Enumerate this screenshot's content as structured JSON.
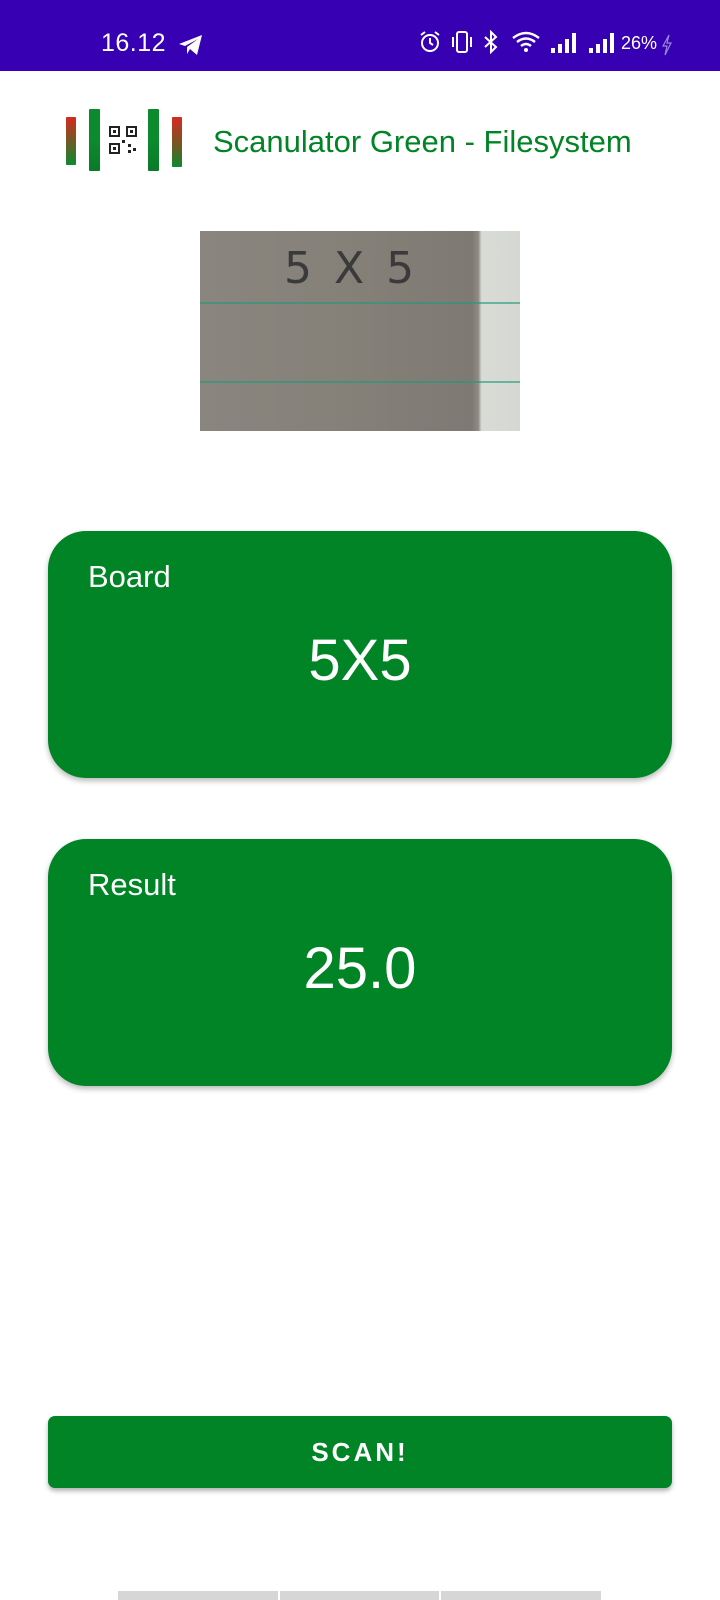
{
  "status_bar": {
    "time": "16.12",
    "battery": "26%",
    "icons": [
      "telegram-icon",
      "alarm-icon",
      "vibrate-icon",
      "bluetooth-icon",
      "wifi-icon",
      "signal-icon",
      "signal-icon",
      "charging-icon"
    ]
  },
  "header": {
    "title": "Scanulator Green - Filesystem",
    "logo": "scanulator-logo"
  },
  "preview": {
    "handwritten_text": "5 X 5"
  },
  "board": {
    "label": "Board",
    "value": "5X5"
  },
  "result": {
    "label": "Result",
    "value": "25.0"
  },
  "scan_button": {
    "label": "SCAN!"
  },
  "colors": {
    "status_bar": "#3700b3",
    "accent_green": "#008425",
    "card_text": "#ffffff",
    "logo_red": "#d62a1f"
  }
}
